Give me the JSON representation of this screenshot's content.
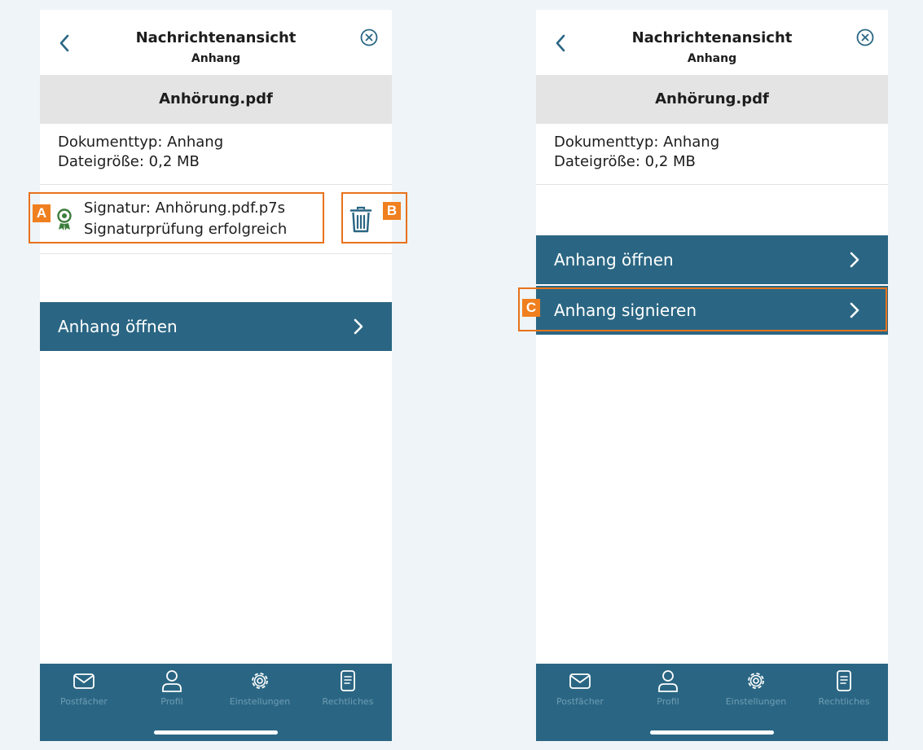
{
  "left_screen": {
    "header": {
      "title": "Nachrichtenansicht",
      "subtitle": "Anhang",
      "back_icon": "chevron-left-icon",
      "close_icon": "close-circle-icon"
    },
    "file_name": "Anhörung.pdf",
    "meta": {
      "doc_type": "Dokumenttyp: Anhang",
      "file_size": "Dateigröße: 0,2 MB"
    },
    "signature": {
      "icon": "certificate-icon",
      "name": "Signatur: Anhörung.pdf.p7s",
      "status": "Signaturprüfung erfolgreich",
      "delete_icon": "trash-icon"
    },
    "actions": [
      {
        "label": "Anhang öffnen"
      }
    ],
    "markers": {
      "a": "A",
      "b": "B"
    }
  },
  "right_screen": {
    "header": {
      "title": "Nachrichtenansicht",
      "subtitle": "Anhang",
      "back_icon": "chevron-left-icon",
      "close_icon": "close-circle-icon"
    },
    "file_name": "Anhörung.pdf",
    "meta": {
      "doc_type": "Dokumenttyp: Anhang",
      "file_size": "Dateigröße: 0,2 MB"
    },
    "actions": [
      {
        "label": "Anhang öffnen"
      },
      {
        "label": "Anhang signieren"
      }
    ],
    "markers": {
      "c": "C"
    }
  },
  "tabbar": {
    "items": [
      {
        "label": "Postfächer",
        "icon": "mail-icon"
      },
      {
        "label": "Profil",
        "icon": "user-icon"
      },
      {
        "label": "Einstellungen",
        "icon": "gear-icon"
      },
      {
        "label": "Rechtliches",
        "icon": "document-icon"
      }
    ]
  },
  "colors": {
    "primary": "#2a6683",
    "accent": "#f07f1f",
    "success": "#3b7d3a",
    "tab_label": "#6f9cb3"
  }
}
